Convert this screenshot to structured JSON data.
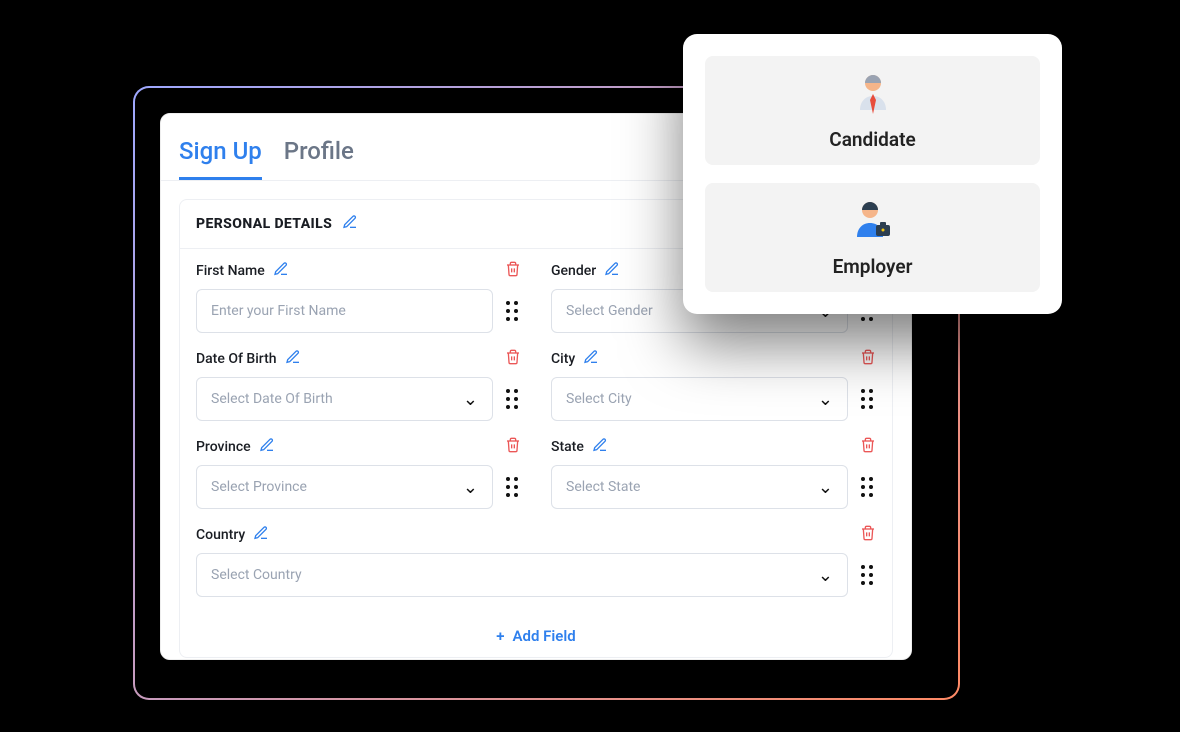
{
  "tabs": {
    "signup": "Sign Up",
    "profile": "Profile"
  },
  "section": {
    "title": "PERSONAL DETAILS"
  },
  "fields": {
    "first_name": {
      "label": "First Name",
      "placeholder": "Enter your First Name"
    },
    "gender": {
      "label": "Gender",
      "placeholder": "Select Gender"
    },
    "dob": {
      "label": "Date Of Birth",
      "placeholder": "Select Date Of Birth"
    },
    "city": {
      "label": "City",
      "placeholder": "Select City"
    },
    "province": {
      "label": "Province",
      "placeholder": "Select Province"
    },
    "state": {
      "label": "State",
      "placeholder": "Select State"
    },
    "country": {
      "label": "Country",
      "placeholder": "Select Country"
    }
  },
  "add_field": "Add Field",
  "roles": {
    "candidate": "Candidate",
    "employer": "Employer"
  }
}
